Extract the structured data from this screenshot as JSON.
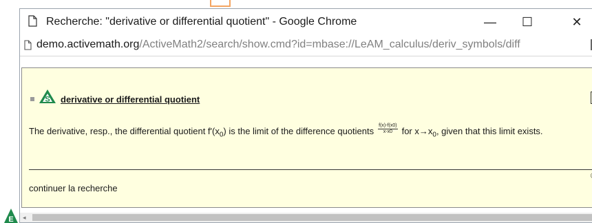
{
  "window": {
    "title": "Recherche: \"derivative or differential quotient\" - Google Chrome",
    "minimize_glyph": "—",
    "maximize_glyph": "☐",
    "close_glyph": "✕"
  },
  "address": {
    "host": "demo.activemath.org",
    "path": "/ActiveMath2/search/show.cmd?id=mbase://LeAM_calculus/deriv_symbols/diff"
  },
  "result": {
    "title": "derivative or differential quotient",
    "icon": "s-symbol-icon",
    "definition_part1": "The derivative, resp., the differential quotient f'(x",
    "sub_0": "0",
    "definition_part2": ") is the limit of the difference quotients",
    "frac_num": "f(x)-f(x0)",
    "frac_den": "x-x0",
    "definition_part3": "for x",
    "arrow": "→",
    "definition_part4": "x",
    "sub_0b": "0",
    "definition_part5": ", given that this limit exists."
  },
  "footer": {
    "continue_label": "continuer la recherche",
    "corner_glyph": "©"
  },
  "colors": {
    "content_bg": "#ffffe0",
    "logo_green": "#1f8a4c"
  },
  "icons": [
    "page-icon",
    "s-symbol-icon",
    "activemath-e-logo"
  ]
}
